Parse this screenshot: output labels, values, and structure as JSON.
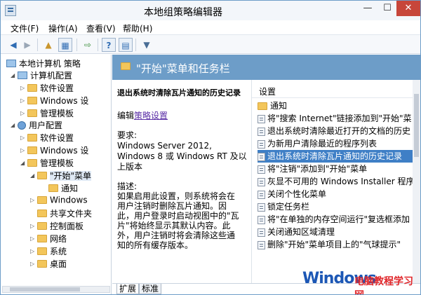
{
  "window": {
    "title": "本地组策略编辑器",
    "min": "—",
    "max": "☐",
    "close": "✕"
  },
  "menu": [
    "文件(F)",
    "操作(A)",
    "查看(V)",
    "帮助(H)"
  ],
  "toolbar": [
    "back-icon",
    "forward-icon",
    "folder-up-icon",
    "show-hide-tree-icon",
    "export-list-icon",
    "help-icon",
    "properties-icon",
    "filter-icon"
  ],
  "tree": [
    {
      "label": "本地计算机 策略",
      "icon": "policy-icon",
      "exp": ""
    },
    {
      "label": "计算机配置",
      "icon": "computer-icon",
      "exp": "◢"
    },
    {
      "label": "软件设置",
      "icon": "folder-icon",
      "exp": "▷"
    },
    {
      "label": "Windows 设",
      "icon": "folder-icon",
      "exp": "▷"
    },
    {
      "label": "管理模板",
      "icon": "folder-icon",
      "exp": "▷"
    },
    {
      "label": "用户配置",
      "icon": "user-icon",
      "exp": "◢"
    },
    {
      "label": "软件设置",
      "icon": "folder-icon",
      "exp": "▷"
    },
    {
      "label": "Windows 设",
      "icon": "folder-icon",
      "exp": "▷"
    },
    {
      "label": "管理模板",
      "icon": "folder-icon",
      "exp": "◢"
    },
    {
      "label": "\"开始\"菜单",
      "icon": "folder-icon",
      "exp": "◢"
    },
    {
      "label": "通知",
      "icon": "folder-icon",
      "exp": ""
    },
    {
      "label": "Windows",
      "icon": "folder-icon",
      "exp": "▷"
    },
    {
      "label": "共享文件夹",
      "icon": "folder-icon",
      "exp": ""
    },
    {
      "label": "控制面板",
      "icon": "folder-icon",
      "exp": "▷"
    },
    {
      "label": "网络",
      "icon": "folder-icon",
      "exp": "▷"
    },
    {
      "label": "系统",
      "icon": "folder-icon",
      "exp": "▷"
    },
    {
      "label": "桌面",
      "icon": "folder-icon",
      "exp": "▷"
    }
  ],
  "header": {
    "title": "\"开始\"菜单和任务栏"
  },
  "description": {
    "title": "退出系统时清除瓦片通知的历史记录",
    "edit_prefix": "编辑",
    "edit_link": "策略设置",
    "req_label": "要求:",
    "req_lines": [
      "Windows Server 2012,",
      "Windows 8 或 Windows RT 及以",
      "上版本"
    ],
    "desc_label": "描述:",
    "desc_text": "如果启用此设置，则系统将会在用户注销时删除瓦片通知。因此，用户登录时启动视图中的\"瓦片\"将始终显示其默认内容。此外，用户注销时将会清除这些通知的所有缓存版本。"
  },
  "settings": {
    "column": "设置",
    "items": [
      {
        "label": "通知",
        "icon": "folder-icon"
      },
      {
        "label": "将\"搜索 Internet\"链接添加到\"开始\"菜",
        "icon": "policy-icon"
      },
      {
        "label": "退出系统时清除最近打开的文档的历史",
        "icon": "policy-icon"
      },
      {
        "label": "为新用户清除最近的程序列表",
        "icon": "policy-icon"
      },
      {
        "label": "退出系统时清除瓦片通知的历史记录",
        "icon": "policy-icon",
        "selected": true
      },
      {
        "label": "将\"注销\"添加到\"开始\"菜单",
        "icon": "policy-icon"
      },
      {
        "label": "灰显不可用的 Windows Installer 程序",
        "icon": "policy-icon"
      },
      {
        "label": "关闭个性化菜单",
        "icon": "policy-icon"
      },
      {
        "label": "锁定任务栏",
        "icon": "policy-icon"
      },
      {
        "label": "将\"在单独的内存空间运行\"复选框添加",
        "icon": "policy-icon"
      },
      {
        "label": "关闭通知区域清理",
        "icon": "policy-icon"
      },
      {
        "label": "删除\"开始\"菜单项目上的\"气球提示\"",
        "icon": "policy-icon"
      }
    ]
  },
  "tabs": [
    "扩展",
    "标准"
  ],
  "logo": {
    "main": "Windows",
    "sub": "电脑教程学习网"
  }
}
